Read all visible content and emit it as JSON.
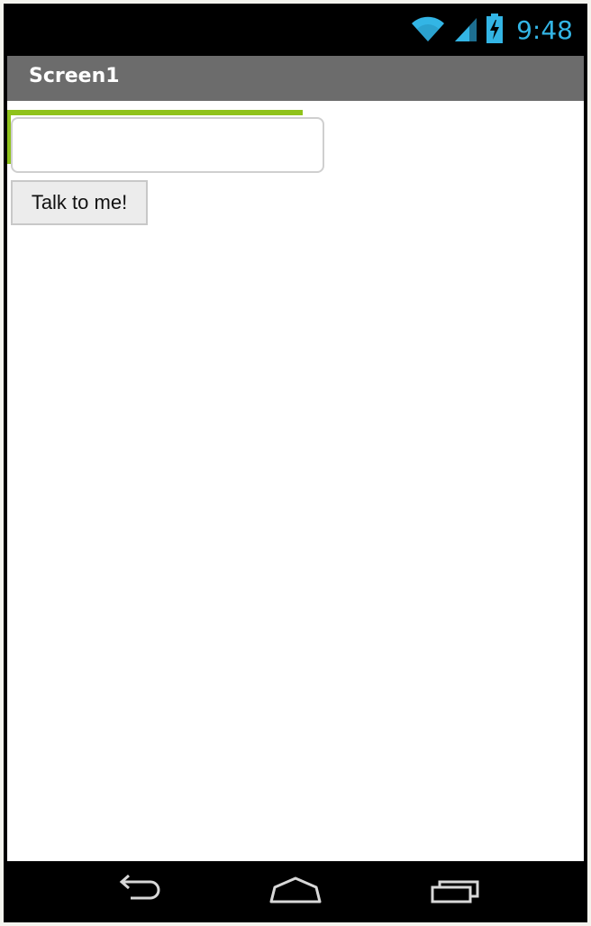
{
  "status_bar": {
    "time": "9:48",
    "icons": [
      "wifi-icon",
      "signal-icon",
      "battery-charging-icon"
    ],
    "accent_color": "#33b5e5"
  },
  "title_bar": {
    "title": "Screen1",
    "background": "#6c6c6c"
  },
  "screen": {
    "text_box": {
      "value": "",
      "focus_color": "#8fc21a"
    },
    "talk_button": {
      "label": "Talk to me!"
    }
  },
  "nav_bar": {
    "buttons": [
      "back-icon",
      "home-icon",
      "recent-apps-icon"
    ]
  }
}
